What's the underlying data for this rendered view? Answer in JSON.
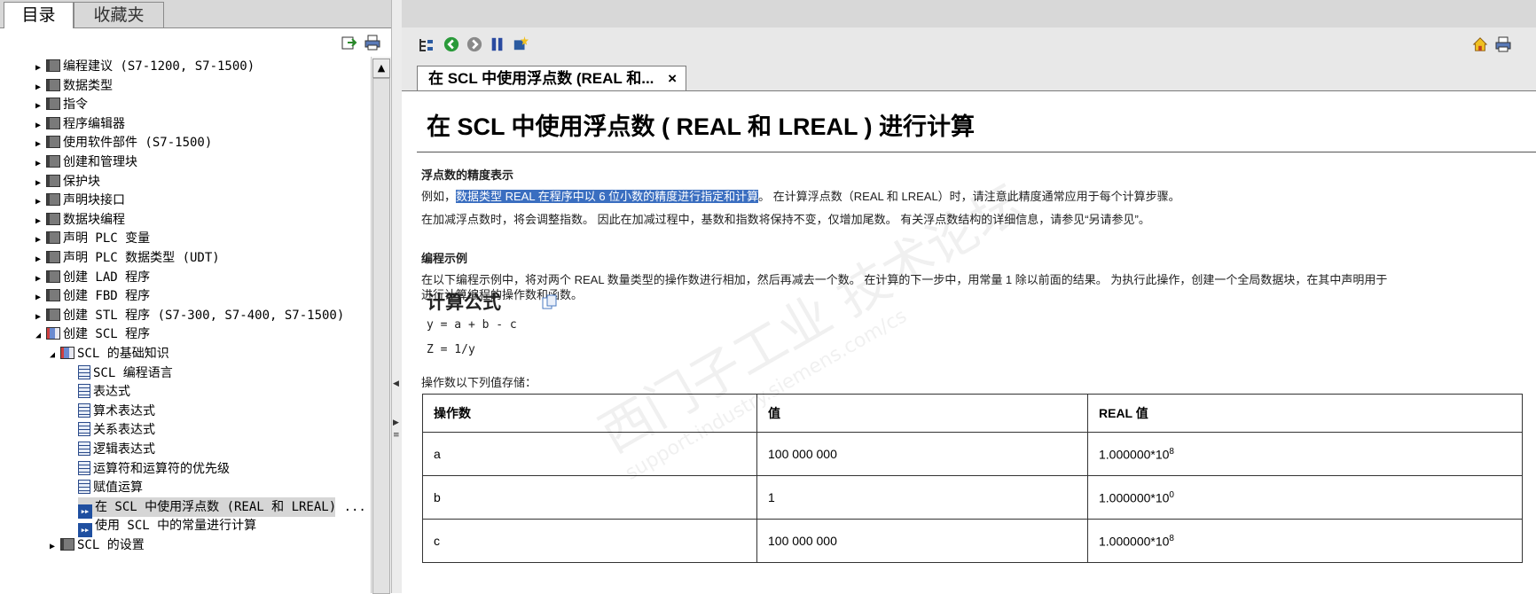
{
  "left_panel": {
    "tabs": [
      {
        "label": "目录",
        "active": true
      },
      {
        "label": "收藏夹",
        "active": false
      }
    ],
    "toolbar_icons": [
      "export-icon",
      "print-icon"
    ],
    "tree": [
      {
        "label": "编程建议 (S7-1200, S7-1500)",
        "level": 0,
        "type": "book",
        "expanded": false
      },
      {
        "label": "数据类型",
        "level": 0,
        "type": "book",
        "expanded": false
      },
      {
        "label": "指令",
        "level": 0,
        "type": "book",
        "expanded": false
      },
      {
        "label": "程序编辑器",
        "level": 0,
        "type": "book",
        "expanded": false
      },
      {
        "label": "使用软件部件 (S7-1500)",
        "level": 0,
        "type": "book",
        "expanded": false
      },
      {
        "label": "创建和管理块",
        "level": 0,
        "type": "book",
        "expanded": false
      },
      {
        "label": "保护块",
        "level": 0,
        "type": "book",
        "expanded": false
      },
      {
        "label": "声明块接口",
        "level": 0,
        "type": "book",
        "expanded": false
      },
      {
        "label": "数据块编程",
        "level": 0,
        "type": "book",
        "expanded": false
      },
      {
        "label": "声明 PLC 变量",
        "level": 0,
        "type": "book",
        "expanded": false
      },
      {
        "label": "声明 PLC 数据类型 (UDT)",
        "level": 0,
        "type": "book",
        "expanded": false
      },
      {
        "label": "创建 LAD 程序",
        "level": 0,
        "type": "book",
        "expanded": false
      },
      {
        "label": "创建 FBD 程序",
        "level": 0,
        "type": "book",
        "expanded": false
      },
      {
        "label": "创建 STL 程序 (S7-300, S7-400, S7-1500)",
        "level": 0,
        "type": "book",
        "expanded": false
      },
      {
        "label": "创建 SCL 程序",
        "level": 0,
        "type": "book-open",
        "expanded": true
      },
      {
        "label": "SCL 的基础知识",
        "level": 1,
        "type": "book-open",
        "expanded": true
      },
      {
        "label": "SCL 编程语言",
        "level": 2,
        "type": "page"
      },
      {
        "label": "表达式",
        "level": 2,
        "type": "page"
      },
      {
        "label": "算术表达式",
        "level": 2,
        "type": "page"
      },
      {
        "label": "关系表达式",
        "level": 2,
        "type": "page"
      },
      {
        "label": "逻辑表达式",
        "level": 2,
        "type": "page"
      },
      {
        "label": "运算符和运算符的优先级",
        "level": 2,
        "type": "page"
      },
      {
        "label": "赋值运算",
        "level": 2,
        "type": "page"
      },
      {
        "label": "在 SCL 中使用浮点数 (REAL 和 LREAL) ...",
        "level": 2,
        "type": "current",
        "selected": true
      },
      {
        "label": "使用 SCL 中的常量进行计算",
        "level": 2,
        "type": "current"
      },
      {
        "label": "SCL 的设置",
        "level": 1,
        "type": "book",
        "expanded": false
      }
    ]
  },
  "right_panel": {
    "toolbar_icons": [
      "sync-toc-icon",
      "back-icon",
      "forward-icon",
      "bookmark-icon",
      "new-favorite-icon"
    ],
    "right_icons": [
      "home-icon",
      "print-icon"
    ],
    "tab_label": "在 SCL 中使用浮点数 (REAL 和...",
    "tab_close": "×",
    "title": "在 SCL 中使用浮点数 ( REAL 和 LREAL ) 进行计算",
    "section1_title": "浮点数的精度表示",
    "section1_p1_prefix": "例如，",
    "section1_p1_highlight": "数据类型 REAL 在程序中以 6 位小数的精度进行指定和计算",
    "section1_p1_suffix": "。 在计算浮点数（REAL 和 LREAL）时，请注意此精度通常应用于每个计算步骤。",
    "section1_p2": "在加减浮点数时，将会调整指数。 因此在加减过程中，基数和指数将保持不变，仅增加尾数。 有关浮点数结构的详细信息，请参见“另请参见”。",
    "section2_title": "编程示例",
    "section2_p1": "在以下编程示例中，将对两个 REAL 数量类型的操作数进行相加，然后再减去一个数。 在计算的下一步中，用常量 1 除以前面的结果。 为执行此操作，创建一个全局数据块，在其中声明用于",
    "section2_p2": "进行计算编程的操作数和函数。",
    "formula_title": "计算公式",
    "formula_line1": "y = a + b - c",
    "formula_line2": "Z = 1/y",
    "table_intro": "操作数以下列值存储：",
    "table": {
      "headers": [
        "操作数",
        "值",
        "REAL 值"
      ],
      "rows": [
        {
          "operand": "a",
          "value": "100 000 000",
          "real_base": "1.000000*10",
          "real_exp": "8"
        },
        {
          "operand": "b",
          "value": "1",
          "real_base": "1.000000*10",
          "real_exp": "0"
        },
        {
          "operand": "c",
          "value": "100 000 000",
          "real_base": "1.000000*10",
          "real_exp": "8"
        }
      ]
    },
    "watermark": "西门子工业 技术论坛",
    "watermark_url": "support.industry.siemens.com/cs"
  },
  "colors": {
    "highlight": "#3a6ec0",
    "tab_bar": "#d8d8d8",
    "toolbar": "#e8e8e8"
  }
}
